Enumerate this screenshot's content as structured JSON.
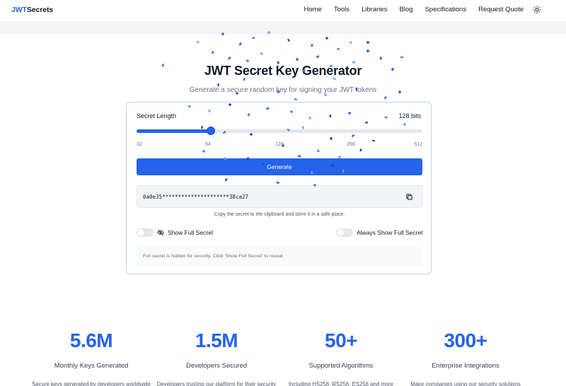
{
  "nav": {
    "logo_a": "JWT",
    "logo_b": "Secrets",
    "links": [
      "Home",
      "Tools",
      "Libraries",
      "Blog",
      "Specifications",
      "Request Quote"
    ]
  },
  "header": {
    "title": "JWT Secret Key Generator",
    "subtitle": "Generate a secure random key for signing your JWT tokens"
  },
  "generator": {
    "length_label": "Secret Length",
    "bits_label": "128 bits",
    "slider": {
      "min": 32,
      "max": 512,
      "value": 128,
      "ticks": [
        "32",
        "64",
        "128",
        "256",
        "512"
      ]
    },
    "generate_label": "Generate",
    "secret_value": "0a0e35*********************38ca27",
    "copy_hint": "Copy the secret to the clipboard and store it in a safe place.",
    "show_full_label": "Show Full Secret",
    "always_show_label": "Always Show Full Secret",
    "info_text": "Full secret is hidden for security. Click 'Show Full Secret' to reveal."
  },
  "stats": [
    {
      "value": "5.6M",
      "label": "Monthly Keys Generated",
      "desc": "Secure keys generated by developers worldwide"
    },
    {
      "value": "1.5M",
      "label": "Developers Secured",
      "desc": "Developers trusting our platform for their security needs"
    },
    {
      "value": "50+",
      "label": "Supported Algorithms",
      "desc": "Including HS256, RS256, ES256 and more"
    },
    {
      "value": "300+",
      "label": "Enterprise Integrations",
      "desc": "Major companies using our security solutions"
    }
  ],
  "colors": {
    "accent": "#2563eb",
    "border": "#bcd3f2"
  },
  "icons": {
    "theme": "sun-icon",
    "copy": "copy-icon",
    "eye": "eye-off-icon"
  }
}
